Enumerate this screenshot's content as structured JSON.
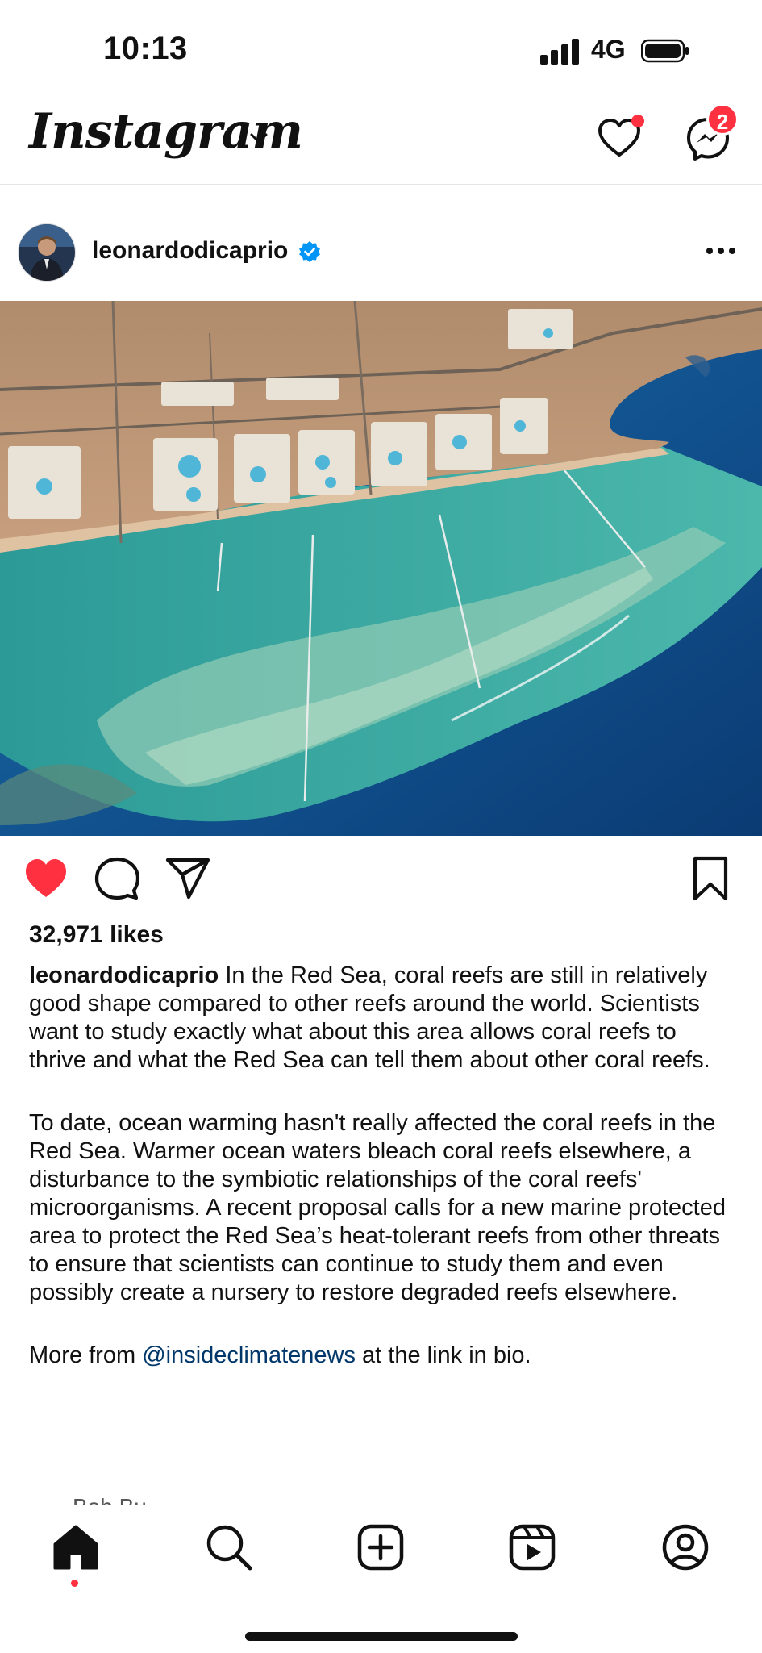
{
  "status_bar": {
    "time": "10:13",
    "network": "4G"
  },
  "top_bar": {
    "logo": "Instagram",
    "messages_badge": "2",
    "icons": [
      "chevron-down-icon",
      "heart-icon",
      "messenger-icon"
    ]
  },
  "post": {
    "username": "leonardodicaprio",
    "likes": "32,971 likes",
    "image_alt": "Aerial view of Red Sea coastline with coral reefs",
    "caption": {
      "username": "leonardodicaprio",
      "para1": "In the Red Sea, coral reefs are still in relatively good shape compared to other reefs around the world. Scientists want to study exactly what about this area allows coral reefs to thrive and what the Red Sea can tell them about other coral reefs.",
      "para2": "To date, ocean warming hasn't really affected the coral reefs in the Red Sea. Warmer ocean waters bleach coral reefs elsewhere, a disturbance to the symbiotic relationships of the coral reefs' microorganisms. A recent proposal calls for a new marine protected area to protect the Red Sea’s heat-tolerant reefs from other threats to ensure that scientists can continue to study them and even possibly create a nursery to restore degraded reefs elsewhere.",
      "para3_prefix": "More from ",
      "para3_mention": "@insideclimatenews",
      "para3_suffix": " at the link in bio."
    },
    "next_partial": "Bob Bu..."
  },
  "tab_bar": {
    "items": [
      "home-icon",
      "search-icon",
      "create-icon",
      "reels-icon",
      "profile-icon"
    ],
    "active": "home"
  },
  "colors": {
    "accent_red": "#ff3040",
    "mention_blue": "#00376b",
    "verified_blue": "#0095f6"
  }
}
